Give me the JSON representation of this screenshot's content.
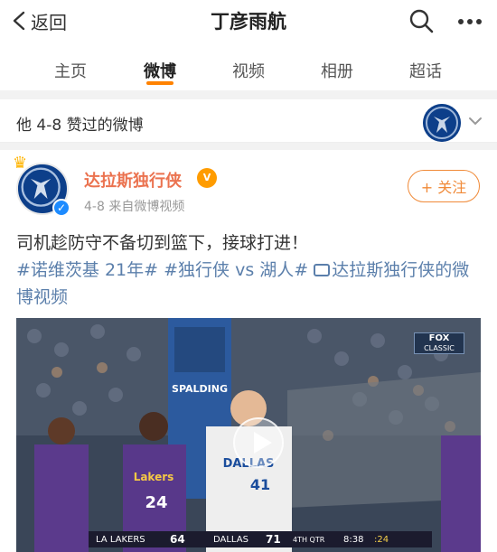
{
  "header": {
    "back_label": "返回",
    "title": "丁彦雨航"
  },
  "tabs": [
    {
      "label": "主页"
    },
    {
      "label": "微博",
      "active": true
    },
    {
      "label": "视频"
    },
    {
      "label": "相册"
    },
    {
      "label": "超话"
    }
  ],
  "liked": {
    "text": "他 4-8 赞过的微博"
  },
  "post": {
    "author": "达拉斯独行侠",
    "meta": "4-8  来自微博视频",
    "follow_label": "+ 关注",
    "text": "司机趁防守不备切到篮下，接球打进！",
    "topics": [
      "#诺维茨基 21年#",
      "#独行侠 vs 湖人#"
    ],
    "video_link": "达拉斯独行侠的微博视频"
  },
  "video": {
    "fox_top": "FOX",
    "fox_bottom": "CLASSIC",
    "score": {
      "away_team": "LA LAKERS",
      "away_score": "64",
      "home_team": "DALLAS",
      "home_score": "71",
      "quarter": "4TH QTR",
      "clock": "8:38",
      "shot_clock": ":24"
    },
    "banner": "SPALDING",
    "jersey_dallas": "DALLAS",
    "jersey_dallas_number": "41",
    "jersey_lakers": "Lakers",
    "jersey_lakers_number": "24"
  },
  "colors": {
    "accent": "#ff8200",
    "author": "#eb7350",
    "link": "#5b7fab"
  }
}
